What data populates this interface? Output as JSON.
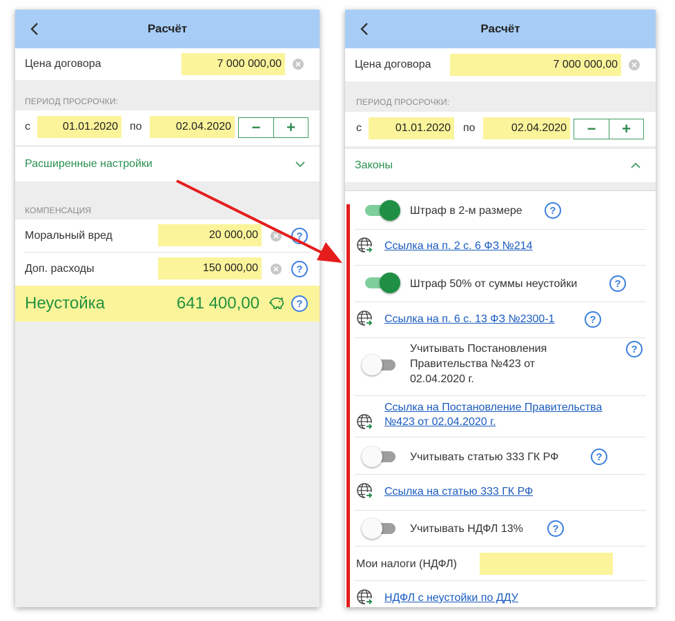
{
  "left": {
    "title": "Расчёт",
    "contract_price": {
      "label": "Цена договора",
      "value": "7 000 000,00"
    },
    "period": {
      "section": "ПЕРИОД ПРОСРОЧКИ:",
      "from_label": "с",
      "from_value": "01.01.2020",
      "to_label": "по",
      "to_value": "02.04.2020",
      "minus": "−",
      "plus": "+"
    },
    "advanced_label": "Расширенные настройки",
    "compensation": {
      "section": "КОМПЕНСАЦИЯ",
      "moral_label": "Моральный вред",
      "moral_value": "20 000,00",
      "extra_label": "Доп. расходы",
      "extra_value": "150 000,00"
    },
    "total": {
      "label": "Неустойка",
      "value": "641 400,00"
    }
  },
  "right": {
    "title": "Расчёт",
    "contract_price": {
      "label": "Цена договора",
      "value": "7 000 000,00"
    },
    "period": {
      "section": "ПЕРИОД ПРОСРОЧКИ:",
      "from_label": "с",
      "from_value": "01.01.2020",
      "to_label": "по",
      "to_value": "02.04.2020",
      "minus": "−",
      "plus": "+"
    },
    "laws_label": "Законы",
    "items": {
      "fine_double": "Штраф в 2-м размере",
      "link_214": "Ссылка на п. 2 с. 6 ФЗ №214",
      "fine_50": "Штраф 50% от суммы неустойки",
      "link_2300": "Ссылка на п. 6 с. 13 ФЗ №2300-1",
      "decree_line1": "Учитывать Постановления",
      "decree_line2": "Правительства №423 от",
      "decree_line3": "02.04.2020 г.",
      "decree_link_line1": "Ссылка на Постановление Правительства",
      "decree_link_line2": "№423 от 02.04.2020 г.",
      "art333": "Учитывать статью 333 ГК РФ",
      "link_333": "Ссылка на статью 333 ГК РФ",
      "ndfl": "Учитывать НДФЛ 13%",
      "my_taxes_label": "Мои налоги (НДФЛ)",
      "my_taxes_value": "",
      "ndfl_link": "НДФЛ с неустойки по ДДУ"
    },
    "toggles": {
      "fine_double": true,
      "fine_50": true,
      "decree": false,
      "art333": false,
      "ndfl": false
    }
  },
  "help_glyph": "?",
  "colors": {
    "appbar": "#a7cdf6",
    "field": "#fbf49a",
    "green": "#23913f",
    "link": "#1a5bbf",
    "annotation": "#e51d1d"
  },
  "icons": [
    "back-arrow-icon",
    "clear-icon",
    "chevron-down-icon",
    "chevron-up-icon",
    "help-icon",
    "piggy-bank-icon",
    "globe-link-icon"
  ]
}
